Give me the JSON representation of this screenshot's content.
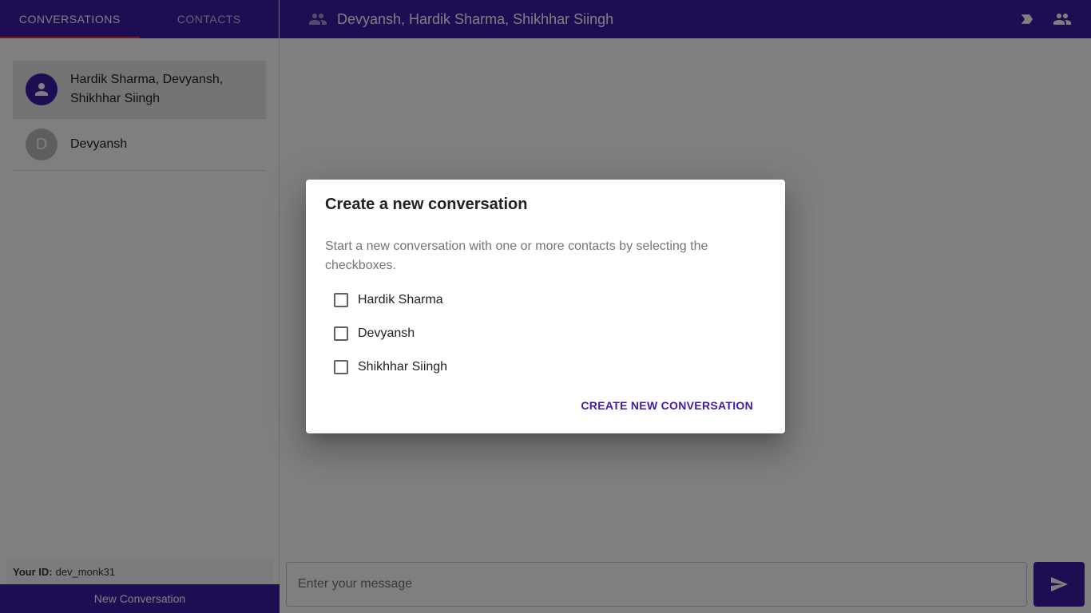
{
  "sidebar": {
    "tabs": [
      {
        "label": "Conversations",
        "active": true
      },
      {
        "label": "Contacts",
        "active": false
      }
    ],
    "conversations": [
      {
        "name": "Hardik Sharma, Devyansh, Shikhhar Siingh",
        "avatar": "person-icon",
        "selected": true
      },
      {
        "name": "Devyansh",
        "avatar_letter": "D",
        "selected": false
      }
    ],
    "your_id_label": "Your ID:",
    "your_id_value": "dev_monk31",
    "new_conversation_label": "New Conversation"
  },
  "header": {
    "title": "Devyansh, Hardik Sharma, Shikhhar Siingh",
    "icons": [
      "people-icon",
      "label-icon",
      "people-icon"
    ]
  },
  "message_bar": {
    "placeholder": "Enter your message",
    "send_icon": "send-icon"
  },
  "dialog": {
    "title": "Create a new conversation",
    "text": "Start a new conversation with one or more contacts by selecting the checkboxes.",
    "contacts": [
      {
        "label": "Hardik Sharma",
        "checked": false
      },
      {
        "label": "Devyansh",
        "checked": false
      },
      {
        "label": "Shikhhar Siingh",
        "checked": false
      }
    ],
    "action_label": "Create New Conversation"
  },
  "colors": {
    "primary": "#3f1aa8",
    "tab_indicator": "#e53935"
  }
}
